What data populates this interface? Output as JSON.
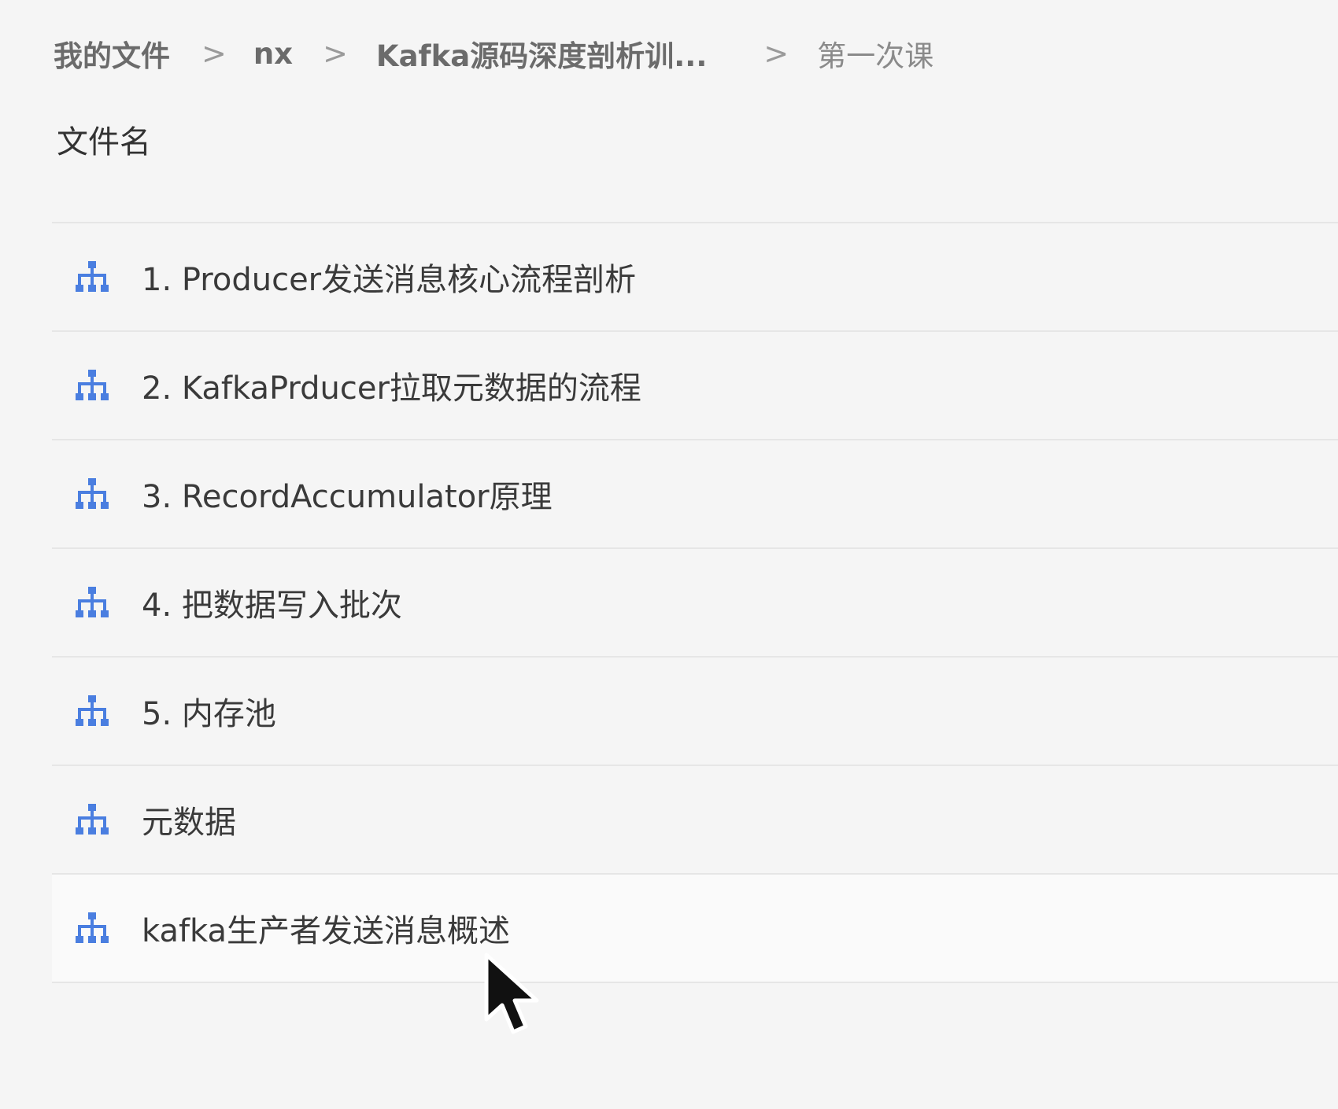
{
  "breadcrumb": {
    "items": [
      "我的文件",
      "nx",
      "Kafka源码深度剖析训...",
      "第一次课"
    ],
    "separator": ">"
  },
  "list_header": {
    "file_name_label": "文件名"
  },
  "files": [
    {
      "name": "1. Producer发送消息核心流程剖析",
      "icon": "mindmap-icon"
    },
    {
      "name": "2. KafkaPrducer拉取元数据的流程",
      "icon": "mindmap-icon"
    },
    {
      "name": "3. RecordAccumulator原理",
      "icon": "mindmap-icon"
    },
    {
      "name": "4. 把数据写入批次",
      "icon": "mindmap-icon"
    },
    {
      "name": "5. 内存池",
      "icon": "mindmap-icon"
    },
    {
      "name": "元数据",
      "icon": "mindmap-icon"
    },
    {
      "name": "kafka生产者发送消息概述",
      "icon": "mindmap-icon"
    }
  ],
  "colors": {
    "icon_blue": "#4a7ee0",
    "background": "#f5f5f5",
    "divider": "#e6e6e6"
  }
}
